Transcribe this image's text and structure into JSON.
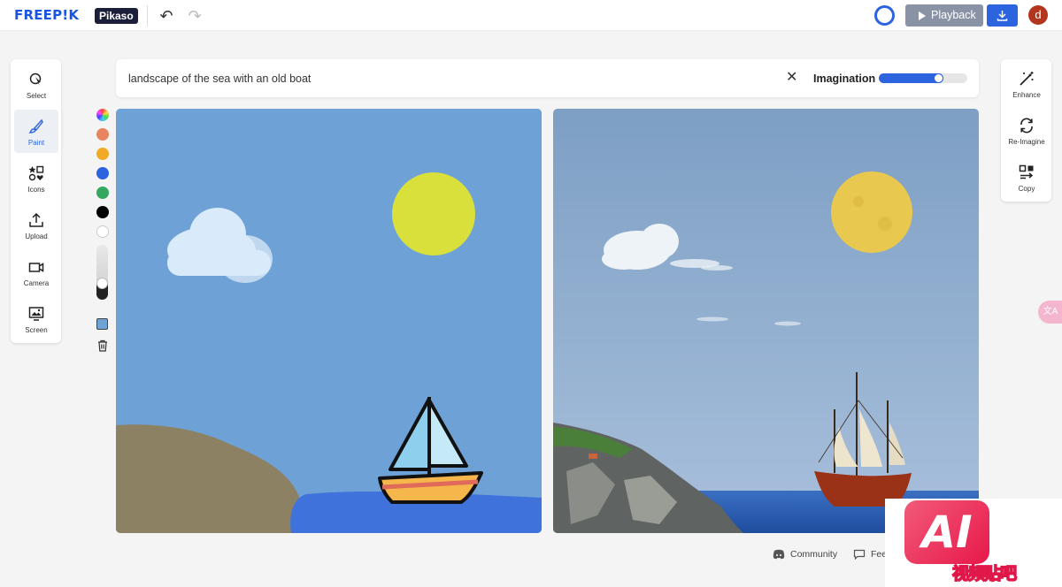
{
  "header": {
    "logo": "FREEP!K",
    "product": "Pikaso",
    "playback_label": "Playback",
    "user_initial": "d"
  },
  "left_toolbar": {
    "items": [
      {
        "label": "Select",
        "icon": "pointer-icon"
      },
      {
        "label": "Paint",
        "icon": "brush-icon",
        "active": true
      },
      {
        "label": "Icons",
        "icon": "shapes-icon"
      },
      {
        "label": "Upload",
        "icon": "upload-icon"
      },
      {
        "label": "Camera",
        "icon": "camera-icon"
      },
      {
        "label": "Screen",
        "icon": "screen-icon"
      }
    ]
  },
  "palette": {
    "colors": [
      "#e8845f",
      "#f0aa25",
      "#2c64e0",
      "#35a85f",
      "#000000",
      "#ffffff"
    ],
    "brush_size_level": 0.3
  },
  "prompt": {
    "text": "landscape of the sea with an old boat",
    "imagination_label": "Imagination",
    "imagination_level": 0.7
  },
  "right_toolbar": {
    "items": [
      {
        "label": "Enhance",
        "icon": "magic-wand-icon"
      },
      {
        "label": "Re-Imagine",
        "icon": "refresh-icon"
      },
      {
        "label": "Copy",
        "icon": "copy-icon"
      }
    ]
  },
  "translate_icon_text": "文A",
  "footer": {
    "community": "Community",
    "feedback": "Fee"
  },
  "watermark": {
    "badge": "AI",
    "text": "视频贴吧"
  }
}
